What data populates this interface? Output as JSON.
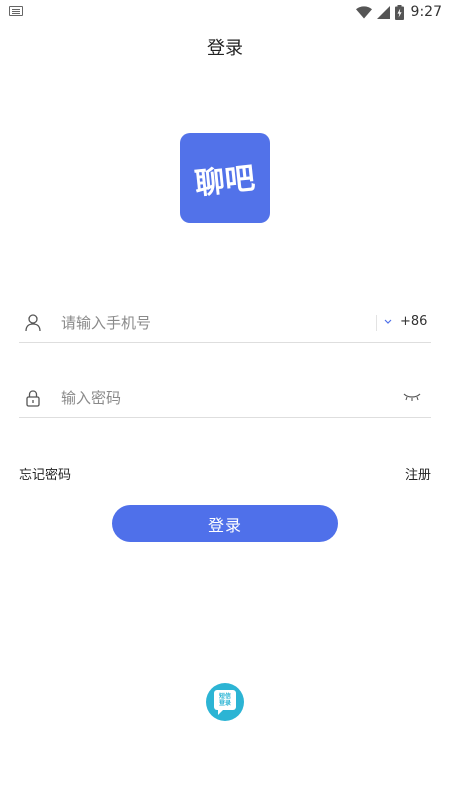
{
  "status_bar": {
    "time": "9:27",
    "icons": [
      "keyboard-icon",
      "wifi-icon",
      "signal-icon",
      "battery-charging-icon"
    ]
  },
  "header": {
    "title": "登录"
  },
  "logo": {
    "text": "聊吧",
    "bg_color": "#5272e9"
  },
  "phone": {
    "placeholder": "请输入手机号",
    "value": "",
    "country_code": "+86",
    "icon": "user-icon"
  },
  "password": {
    "placeholder": "输入密码",
    "value": "",
    "icon": "lock-icon",
    "toggle_icon": "eye-closed-icon"
  },
  "links": {
    "forgot": "忘记密码",
    "register": "注册"
  },
  "login_button": {
    "label": "登录",
    "color": "#4f70ea"
  },
  "sms_login": {
    "line1": "短信",
    "line2": "登录",
    "color": "#2cb4d4"
  }
}
